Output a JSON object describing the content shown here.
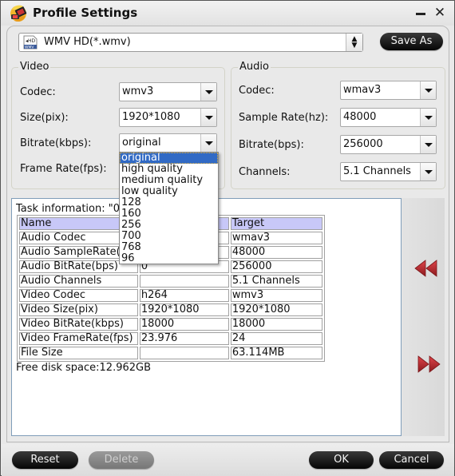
{
  "window": {
    "title": "Profile Settings",
    "app_icon": "video-converter-app-icon",
    "minimize_icon": "minimize-icon",
    "close_glyph": "✕"
  },
  "profile": {
    "selected": "WMV HD(*.wmv)",
    "format_icon": "wmv-hd-file-icon",
    "save_as_label": "Save As"
  },
  "video": {
    "group_label": "Video",
    "codec_label": "Codec:",
    "codec_value": "wmv3",
    "size_label": "Size(pix):",
    "size_value": "1920*1080",
    "bitrate_label": "Bitrate(kbps):",
    "bitrate_value": "original",
    "framerate_label": "Frame Rate(fps):",
    "bitrate_options": [
      "original",
      "high quality",
      "medium quality",
      "low quality",
      "128",
      "160",
      "256",
      "700",
      "768",
      "96"
    ],
    "bitrate_selected_index": 0
  },
  "audio": {
    "group_label": "Audio",
    "codec_label": "Codec:",
    "codec_value": "wmav3",
    "samplerate_label": "Sample Rate(hz):",
    "samplerate_value": "48000",
    "bitrate_label": "Bitrate(bps):",
    "bitrate_value": "256000",
    "channels_label": "Channels:",
    "channels_value": "5.1 Channels"
  },
  "task": {
    "info_label": "Task information: \"00",
    "columns": [
      "Name",
      "",
      "Target"
    ],
    "rows": [
      [
        "Audio Codec",
        "",
        "wmav3"
      ],
      [
        "Audio SampleRate(hz)",
        "",
        "48000"
      ],
      [
        "Audio BitRate(bps)",
        "0",
        "256000"
      ],
      [
        "Audio Channels",
        "",
        "5.1 Channels"
      ],
      [
        "Video Codec",
        "h264",
        "wmv3"
      ],
      [
        "Video Size(pix)",
        "1920*1080",
        "1920*1080"
      ],
      [
        "Video BitRate(kbps)",
        "18000",
        "18000"
      ],
      [
        "Video FrameRate(fps)",
        "23.976",
        "24"
      ],
      [
        "File Size",
        "",
        "63.114MB"
      ]
    ],
    "free_disk": "Free disk space:12.962GB"
  },
  "nav": {
    "collapse_icon": "double-left-arrow-icon",
    "expand_icon": "double-right-arrow-icon",
    "arrow_color": "#c0282c"
  },
  "footer": {
    "reset_label": "Reset",
    "delete_label": "Delete",
    "ok_label": "OK",
    "cancel_label": "Cancel"
  }
}
